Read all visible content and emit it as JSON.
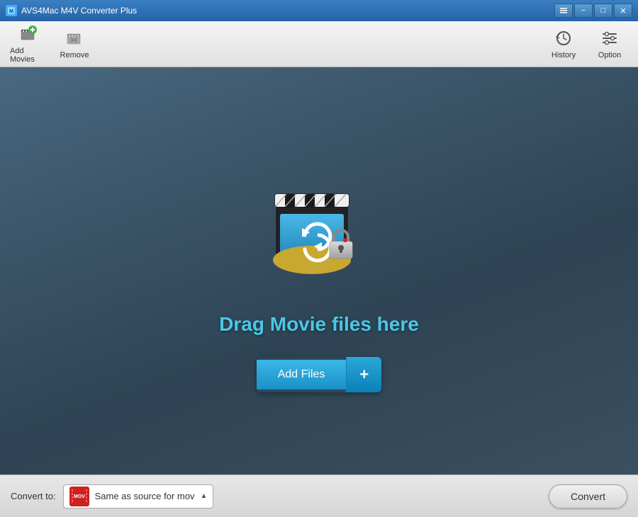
{
  "titleBar": {
    "title": "AVS4Mac M4V Converter Plus",
    "controls": {
      "minimize": "−",
      "maximize": "□",
      "close": "✕"
    }
  },
  "toolbar": {
    "addMovies": {
      "label": "Add Movies"
    },
    "remove": {
      "label": "Remove"
    },
    "history": {
      "label": "History"
    },
    "option": {
      "label": "Option"
    }
  },
  "main": {
    "dragText": "Drag Movie files here",
    "addFilesLabel": "Add Files",
    "addFilesPlus": "+"
  },
  "bottomBar": {
    "convertToLabel": "Convert to:",
    "formatIconText": "MOV",
    "formatText": "Same as source for mov",
    "convertLabel": "Convert"
  }
}
